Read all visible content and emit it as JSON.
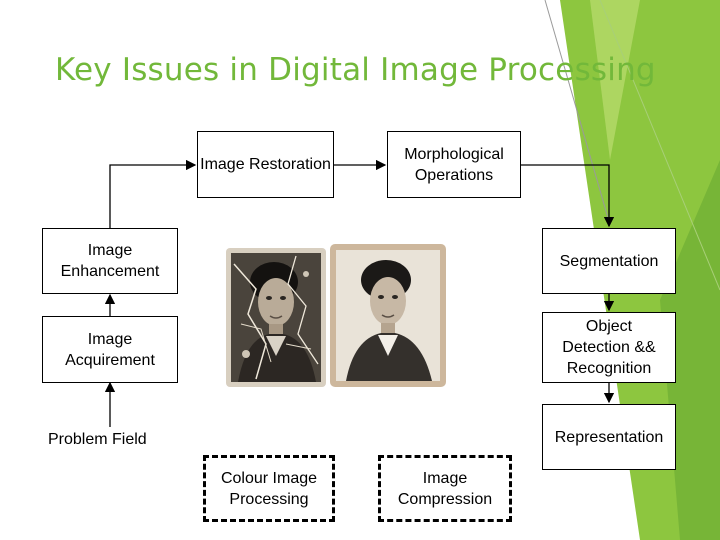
{
  "slide": {
    "title": "Key Issues in Digital Image Processing"
  },
  "diagram": {
    "image_restoration": "Image Restoration",
    "morphological_operations": "Morphological Operations",
    "image_enhancement": "Image Enhancement",
    "segmentation": "Segmentation",
    "image_acquirement": "Image Acquirement",
    "object_detection": "Object Detection && Recognition",
    "problem_field": "Problem Field",
    "representation": "Representation",
    "colour_image_processing": "Colour Image Processing",
    "image_compression": "Image Compression"
  },
  "colors": {
    "title": "#72b83a",
    "accent_green": "#8dc63f",
    "accent_light_green": "#b5d96a"
  }
}
